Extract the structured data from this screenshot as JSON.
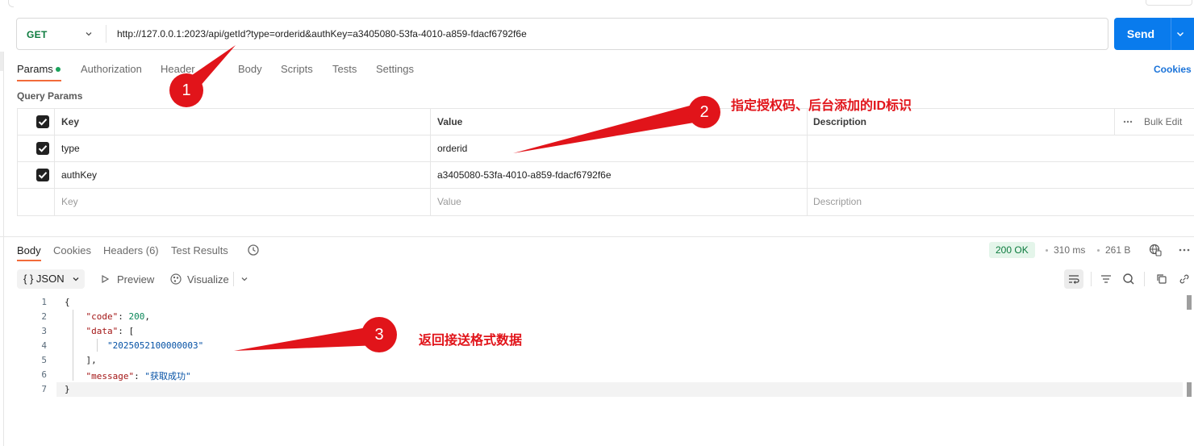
{
  "request": {
    "method": "GET",
    "url": "http://127.0.0.1:2023/api/getId?type=orderid&authKey=a3405080-53fa-4010-a859-fdacf6792f6e",
    "send_label": "Send"
  },
  "req_tabs": {
    "params": "Params",
    "authorization": "Authorization",
    "headers": "Header",
    "body": "Body",
    "scripts": "Scripts",
    "tests": "Tests",
    "settings": "Settings",
    "cookies": "Cookies"
  },
  "query_params": {
    "section_label": "Query Params",
    "headers": {
      "key": "Key",
      "value": "Value",
      "description": "Description",
      "bulk_edit": "Bulk Edit"
    },
    "rows": [
      {
        "key": "type",
        "value": "orderid",
        "checked": true
      },
      {
        "key": "authKey",
        "value": "a3405080-53fa-4010-a859-fdacf6792f6e",
        "checked": true
      }
    ],
    "placeholder": {
      "key": "Key",
      "value": "Value",
      "description": "Description"
    }
  },
  "response": {
    "tabs": {
      "body": "Body",
      "cookies": "Cookies",
      "headers": "Headers (6)",
      "test_results": "Test Results"
    },
    "status": "200 OK",
    "time": "310 ms",
    "size": "261 B",
    "format": "JSON",
    "preview": "Preview",
    "visualize": "Visualize",
    "code_lines": {
      "l1": "{",
      "l2_key": "\"code\"",
      "l2_val": "200",
      "l3_key": "\"data\"",
      "l3_rest": ": [",
      "l4_val": "\"2025052100000003\"",
      "l5": "],",
      "l6_key": "\"message\"",
      "l6_val": "\"获取成功\"",
      "l7": "}"
    },
    "line_numbers": [
      "1",
      "2",
      "3",
      "4",
      "5",
      "6",
      "7"
    ]
  },
  "annotations": {
    "n1": "1",
    "n2": "2",
    "n3": "3",
    "callout2": "指定授权码、后台添加的ID标识",
    "callout3": "返回接送格式数据",
    "color": "#e1141a"
  },
  "colors": {
    "send_button": "#097bed",
    "method_get": "#0c7b3e",
    "active_tab_underline": "#f26b3a",
    "status_ok_bg": "#e4f5ea",
    "cookies_link": "#1a73d9"
  }
}
